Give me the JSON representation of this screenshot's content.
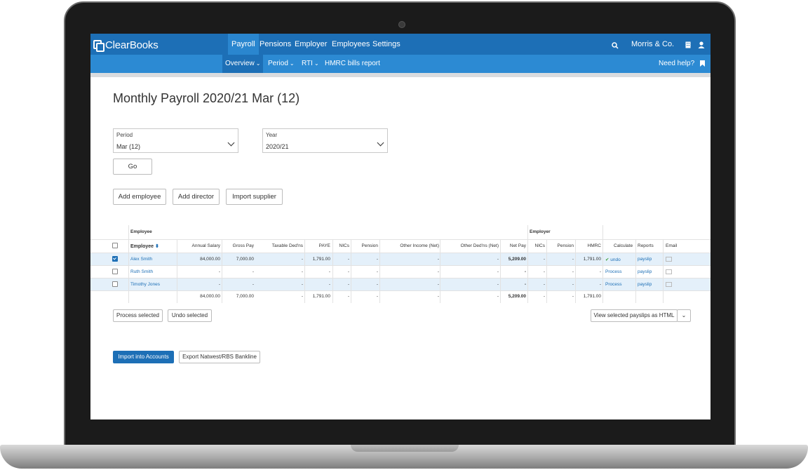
{
  "brand": {
    "name": "ClearBooks"
  },
  "topnav": {
    "items": [
      "Payroll",
      "Pensions",
      "Employer",
      "Employees",
      "Settings"
    ],
    "company": "Morris & Co."
  },
  "subnav": {
    "items": [
      "Overview",
      "Period",
      "RTI",
      "HMRC bills report"
    ],
    "help": "Need help?"
  },
  "page": {
    "title": "Monthly Payroll 2020/21 Mar (12)"
  },
  "filters": {
    "period": {
      "label": "Period",
      "value": "Mar (12)"
    },
    "year": {
      "label": "Year",
      "value": "2020/21"
    },
    "go": "Go"
  },
  "actions": {
    "add_employee": "Add employee",
    "add_director": "Add director",
    "import_supplier": "Import supplier"
  },
  "table": {
    "group_employee": "Employee",
    "group_employer": "Employer",
    "columns": [
      "Employee",
      "Annual Salary",
      "Gross Pay",
      "Taxable Ded'ns",
      "PAYE",
      "NICs",
      "Pension",
      "Other Income (Net)",
      "Other Ded'ns (Net)",
      "Net Pay",
      "NICs",
      "Pension",
      "HMRC",
      "Calculate",
      "Reports",
      "Email"
    ],
    "rows": [
      {
        "checked": true,
        "name": "Alex Smith",
        "annual_salary": "84,000.00",
        "gross_pay": "7,000.00",
        "taxable": "-",
        "paye": "1,791.00",
        "nics": "-",
        "pension": "-",
        "other_income": "-",
        "other_deds": "-",
        "net_pay": "5,209.00",
        "er_nics": "-",
        "er_pension": "-",
        "hmrc": "1,791.00",
        "calculate": "undo",
        "reports": "payslip"
      },
      {
        "checked": false,
        "name": "Ruth Smith",
        "annual_salary": "-",
        "gross_pay": "-",
        "taxable": "-",
        "paye": "-",
        "nics": "-",
        "pension": "-",
        "other_income": "-",
        "other_deds": "-",
        "net_pay": "-",
        "er_nics": "-",
        "er_pension": "-",
        "hmrc": "-",
        "calculate": "Process",
        "reports": "payslip"
      },
      {
        "checked": false,
        "name": "Timothy Jones",
        "annual_salary": "-",
        "gross_pay": "-",
        "taxable": "-",
        "paye": "-",
        "nics": "-",
        "pension": "-",
        "other_income": "-",
        "other_deds": "-",
        "net_pay": "-",
        "er_nics": "-",
        "er_pension": "-",
        "hmrc": "-",
        "calculate": "Process",
        "reports": "payslip"
      }
    ],
    "totals": {
      "annual_salary": "84,000.00",
      "gross_pay": "7,000.00",
      "taxable": "-",
      "paye": "1,791.00",
      "nics": "-",
      "pension": "-",
      "other_income": "-",
      "other_deds": "-",
      "net_pay": "5,209.00",
      "er_nics": "-",
      "er_pension": "-",
      "hmrc": "1,791.00"
    }
  },
  "bulk": {
    "process": "Process selected",
    "undo": "Undo selected",
    "view": "View selected payslips as HTML"
  },
  "export": {
    "import_accounts": "Import into Accounts",
    "bankline": "Export Natwest/RBS Bankline"
  },
  "colors": {
    "brand": "#1d6fb6",
    "subnav": "#2c8ad3",
    "row_highlight": "#e4f0fa"
  }
}
